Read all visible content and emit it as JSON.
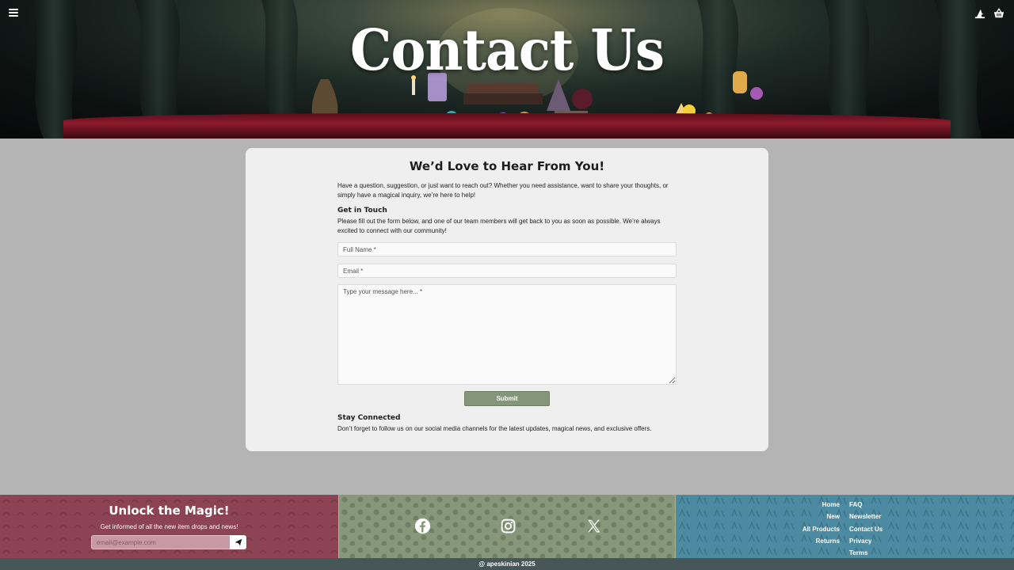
{
  "hero": {
    "title": "Contact Us"
  },
  "header": {
    "menu_icon": "hamburger-menu-icon",
    "icons": [
      "wizard-hat-icon",
      "shopping-basket-icon"
    ]
  },
  "card": {
    "heading": "We’d Love to Hear From You!",
    "intro": "Have a question, suggestion, or just want to reach out? Whether you need assistance, want to share your thoughts, or simply have a magical inquiry, we’re here to help!",
    "get_in_touch_heading": "Get in Touch",
    "get_in_touch_text": "Please fill out the form below, and one of our team members will get back to you as soon as possible. We’re always excited to connect with our community!",
    "form": {
      "name_placeholder": "Full Name *",
      "email_placeholder": "Email *",
      "message_placeholder": "Type your message here... *",
      "submit_label": "Submit"
    },
    "stay_connected_heading": "Stay Connected",
    "stay_connected_text": "Don’t forget to follow us on our social media channels for the latest updates, magical news, and exclusive offers."
  },
  "footer": {
    "newsletter": {
      "title": "Unlock the Magic!",
      "subtitle": "Get informed of all the new item drops and news!",
      "email_placeholder": "email@example.com"
    },
    "social": [
      "facebook-icon",
      "instagram-icon",
      "x-icon"
    ],
    "links_left": [
      "Home",
      "New",
      "All Products",
      "Returns"
    ],
    "links_right": [
      "FAQ",
      "Newsletter",
      "Contact Us",
      "Privacy",
      "Terms"
    ],
    "copyright": "@ apeskinian 2025"
  },
  "colors": {
    "background": "#b4b4b4",
    "card": "#efefef",
    "submit": "#84967a",
    "footer_red": "#8c4354",
    "footer_green": "#869879",
    "footer_blue": "#4c8aa2",
    "copyright_bar": "#455558"
  }
}
